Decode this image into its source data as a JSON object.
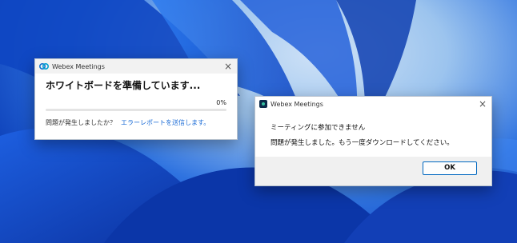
{
  "colors": {
    "desktop_deep": "#0c3fb8",
    "desktop_light": "#cfe2f7",
    "accent": "#1170cf",
    "link": "#1a6bd6"
  },
  "dialog_progress": {
    "window_title": "Webex Meetings",
    "title_icon": "webex-logo-icon",
    "close_icon": "close-icon",
    "heading": "ホワイトボードを準備しています...",
    "progress_percent": "0%",
    "progress_value": 0,
    "footer_text": "問題が発生しましたか？",
    "footer_link": "エラーレポートを送信します。"
  },
  "dialog_error": {
    "window_title": "Webex Meetings",
    "title_icon": "webex-app-icon",
    "close_icon": "close-icon",
    "message_1": "ミーティングに参加できません",
    "message_2": "問題が発生しました。もう一度ダウンロードしてください。",
    "ok_label": "OK"
  }
}
